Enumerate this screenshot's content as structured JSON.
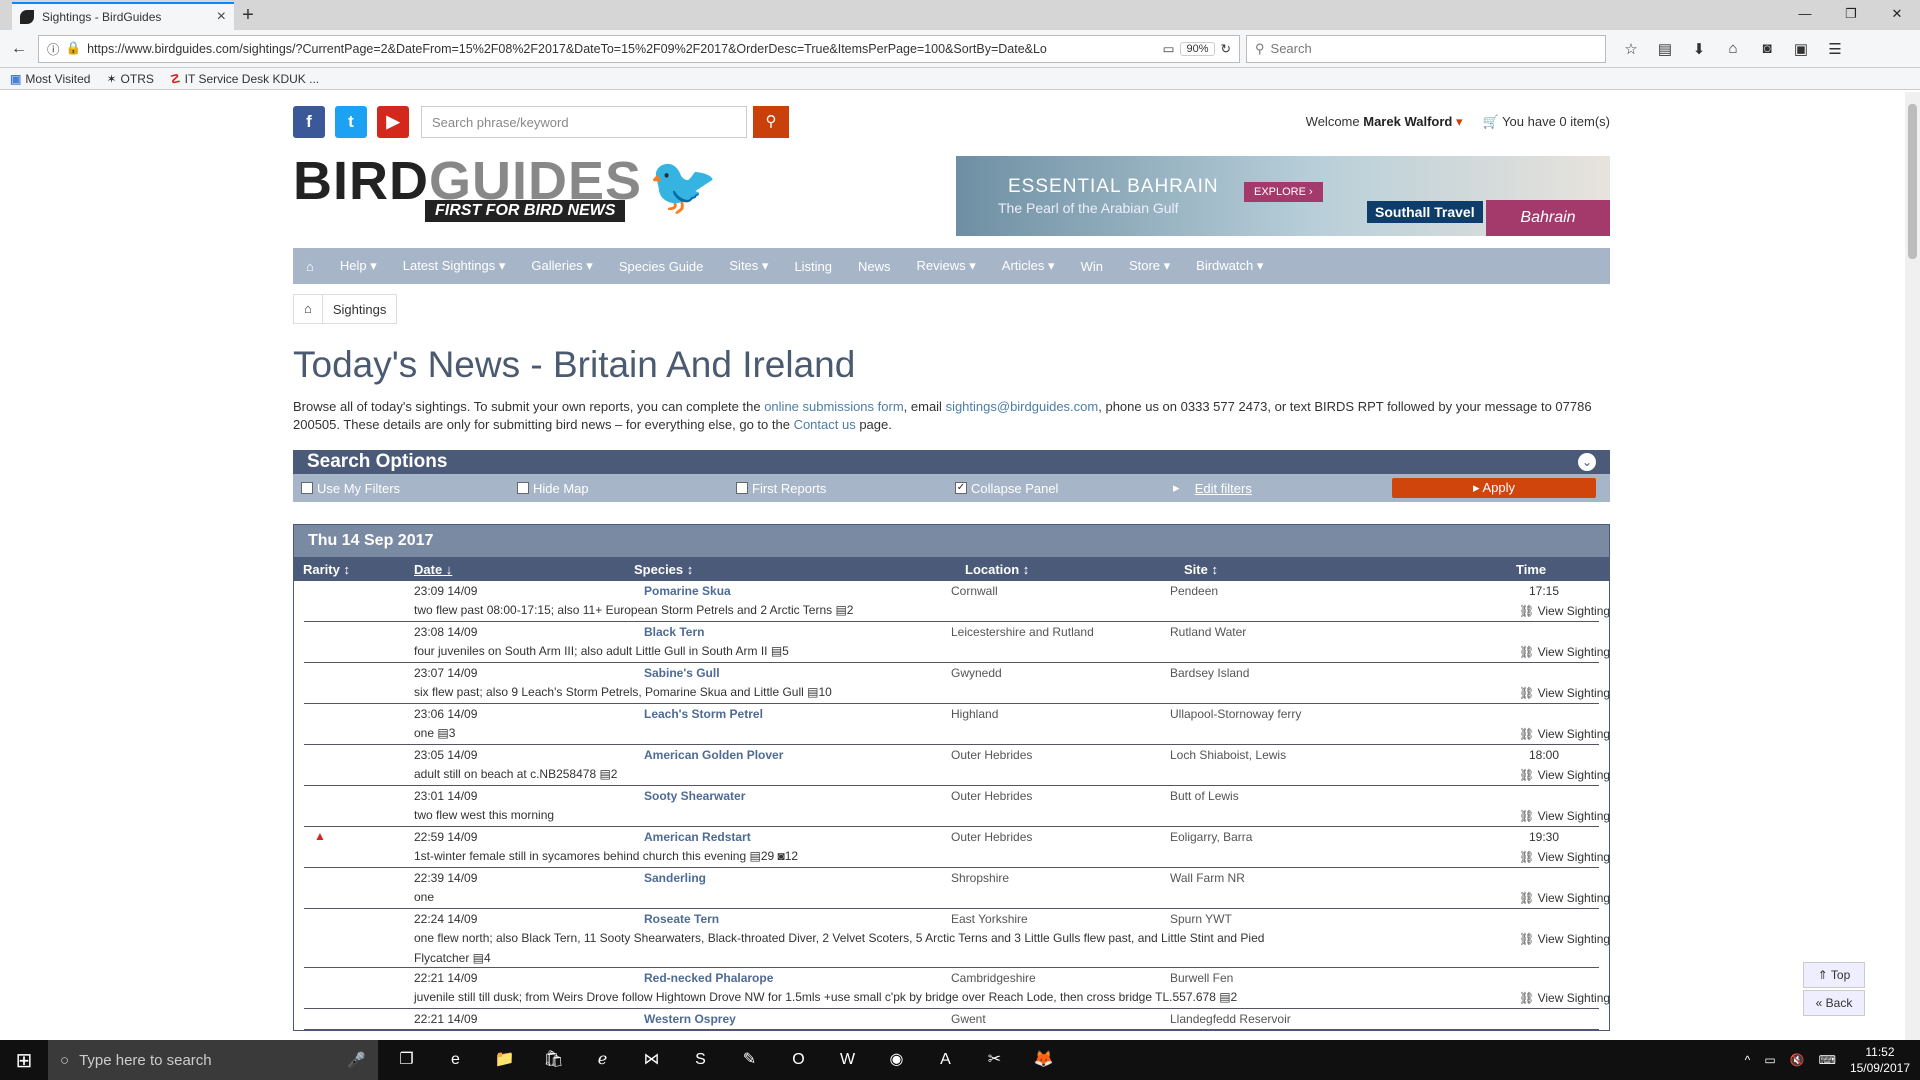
{
  "browser": {
    "tab_title": "Sightings - BirdGuides",
    "url": "https://www.birdguides.com/sightings/?CurrentPage=2&DateFrom=15%2F08%2F2017&DateTo=15%2F09%2F2017&OrderDesc=True&ItemsPerPage=100&SortBy=Date&Lo",
    "zoom": "90%",
    "search_placeholder": "Search",
    "bookmarks": [
      "Most Visited",
      "OTRS",
      "IT Service Desk KDUK ..."
    ]
  },
  "site": {
    "search_placeholder": "Search phrase/keyword",
    "welcome_prefix": "Welcome",
    "user_name": "Marek Walford",
    "cart": "You have 0 item(s)",
    "logo_main": "BIRD",
    "logo_main2": "GUIDES",
    "logo_tag": "FIRST FOR BIRD NEWS",
    "ad": {
      "title": "ESSENTIAL BAHRAIN",
      "subtitle": "The Pearl of the Arabian Gulf",
      "explore": "EXPLORE",
      "brand": "Southall Travel",
      "script": "Bahrain"
    },
    "nav": [
      "Help ▾",
      "Latest Sightings ▾",
      "Galleries ▾",
      "Species Guide",
      "Sites ▾",
      "Listing",
      "News",
      "Reviews ▾",
      "Articles ▾",
      "Win",
      "Store ▾",
      "Birdwatch ▾"
    ],
    "breadcrumb": "Sightings"
  },
  "page": {
    "title": "Today's News - Britain And Ireland",
    "intro": {
      "p1": "Browse all of today's sightings. To submit your own reports, you can complete the ",
      "link1": "online submissions form",
      "p2": ", email ",
      "email": "sightings@birdguides.com",
      "p3": ", phone us on 0333 577 2473, or text BIRDS RPT followed by your message to 07786 200505. These details are only for submitting bird news – for everything else, go to the ",
      "link2": "Contact us",
      "p4": " page."
    }
  },
  "search_options": {
    "title": "Search Options",
    "use_my_filters": "Use My Filters",
    "hide_map": "Hide Map",
    "first_reports": "First Reports",
    "collapse_panel": "Collapse Panel",
    "edit_filters": "Edit filters",
    "apply": "Apply"
  },
  "results": {
    "date_header": "Thu 14 Sep 2017",
    "columns": {
      "rarity": "Rarity",
      "date": "Date",
      "species": "Species",
      "location": "Location",
      "site": "Site",
      "time": "Time"
    },
    "view_label": "View Sighting",
    "rows": [
      {
        "date": "23:09 14/09",
        "species": "Pomarine Skua",
        "location": "Cornwall",
        "site": "Pendeen",
        "time": "17:15",
        "desc": "two flew past 08:00-17:15; also 11+ European Storm Petrels and 2 Arctic Terns ▤2",
        "rare": false
      },
      {
        "date": "23:08 14/09",
        "species": "Black Tern",
        "location": "Leicestershire and Rutland",
        "site": "Rutland Water",
        "time": "",
        "desc": "four juveniles on South Arm III; also adult Little Gull in South Arm II ▤5",
        "rare": false
      },
      {
        "date": "23:07 14/09",
        "species": "Sabine's Gull",
        "location": "Gwynedd",
        "site": "Bardsey Island",
        "time": "",
        "desc": "six flew past; also 9 Leach's Storm Petrels, Pomarine Skua and Little Gull ▤10",
        "rare": false
      },
      {
        "date": "23:06 14/09",
        "species": "Leach's Storm Petrel",
        "location": "Highland",
        "site": "Ullapool-Stornoway ferry",
        "time": "",
        "desc": "one ▤3",
        "rare": false
      },
      {
        "date": "23:05 14/09",
        "species": "American Golden Plover",
        "location": "Outer Hebrides",
        "site": "Loch Shiaboist, Lewis",
        "time": "18:00",
        "desc": "adult still on beach at c.NB258478 ▤2",
        "rare": false
      },
      {
        "date": "23:01 14/09",
        "species": "Sooty Shearwater",
        "location": "Outer Hebrides",
        "site": "Butt of Lewis",
        "time": "",
        "desc": "two flew west this morning",
        "rare": false
      },
      {
        "date": "22:59 14/09",
        "species": "American Redstart",
        "location": "Outer Hebrides",
        "site": "Eoligarry, Barra",
        "time": "19:30",
        "desc": "1st-winter female still in sycamores behind church this evening ▤29 ◙12",
        "rare": true
      },
      {
        "date": "22:39 14/09",
        "species": "Sanderling",
        "location": "Shropshire",
        "site": "Wall Farm NR",
        "time": "",
        "desc": "one",
        "rare": false
      },
      {
        "date": "22:24 14/09",
        "species": "Roseate Tern",
        "location": "East Yorkshire",
        "site": "Spurn YWT",
        "time": "",
        "desc": "one flew north; also Black Tern, 11 Sooty Shearwaters, Black-throated Diver, 2 Velvet Scoters, 5 Arctic Terns and 3 Little Gulls flew past, and Little Stint and Pied",
        "desc2": "Flycatcher ▤4",
        "rare": false
      },
      {
        "date": "22:21 14/09",
        "species": "Red-necked Phalarope",
        "location": "Cambridgeshire",
        "site": "Burwell Fen",
        "time": "",
        "desc": "juvenile still till dusk; from Weirs Drove follow Hightown Drove NW for 1.5mls +use small c'pk by bridge over Reach Lode, then cross bridge TL.557.678 ▤2",
        "rare": false
      },
      {
        "date": "22:21 14/09",
        "species": "Western Osprey",
        "location": "Gwent",
        "site": "Llandegfedd Reservoir",
        "time": "",
        "desc": "",
        "rare": false
      }
    ]
  },
  "side_buttons": {
    "top": "Top",
    "back": "Back"
  },
  "taskbar": {
    "search_placeholder": "Type here to search",
    "time": "11:52",
    "date": "15/09/2017"
  }
}
